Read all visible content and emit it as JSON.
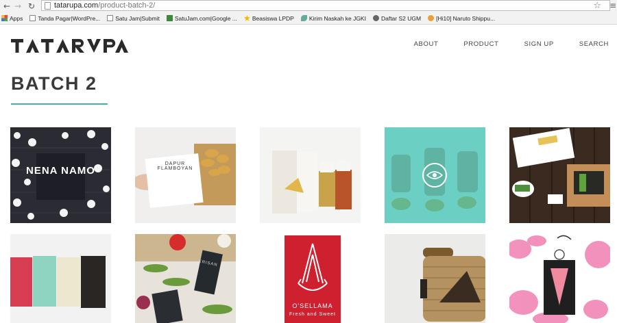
{
  "browser": {
    "url_host": "tatarupa.com",
    "url_path": "/product-batch-2/",
    "bookmarks": [
      {
        "icon": "apps-icon",
        "label": "Apps"
      },
      {
        "icon": "page-icon",
        "label": "Tanda Pagar|WordPre..."
      },
      {
        "icon": "page-icon",
        "label": "Satu Jam|Submit"
      },
      {
        "icon": "satujam-icon",
        "label": "SatuJam.com|Google ..."
      },
      {
        "icon": "star-icon",
        "label": "Beasiswa LPDP"
      },
      {
        "icon": "leaf-icon",
        "label": "Kirim Naskah ke JGKI"
      },
      {
        "icon": "gear-icon",
        "label": "Daftar S2 UGM"
      },
      {
        "icon": "ball-icon",
        "label": "[Hi10] Naruto Shippu..."
      }
    ]
  },
  "site": {
    "logo_text": "TATARVPA",
    "nav": [
      "ABOUT",
      "PRODUCT",
      "SIGN UP",
      "SEARCH"
    ],
    "page_title": "BATCH 2"
  },
  "products": [
    {
      "name": "nena-namo",
      "caption": "NENA NAMO"
    },
    {
      "name": "dapur-flamboyan",
      "caption": "DAPUR FLAMBOYAN"
    },
    {
      "name": "packaged-snacks",
      "caption": ""
    },
    {
      "name": "bottles-eye-overlay",
      "caption": ""
    },
    {
      "name": "box-and-cake",
      "caption": ""
    },
    {
      "name": "chocolate-bars",
      "caption": ""
    },
    {
      "name": "flowers-tags",
      "caption": "KRISAN"
    },
    {
      "name": "osellama",
      "caption": "O'SELLAMA",
      "subcaption": "Fresh and Sweet"
    },
    {
      "name": "rattan-bag",
      "caption": ""
    },
    {
      "name": "floral-tag",
      "caption": ""
    }
  ],
  "colors": {
    "accent": "#3fb1b9",
    "title": "#3a3a3a",
    "osellama_red": "#cf2030"
  }
}
